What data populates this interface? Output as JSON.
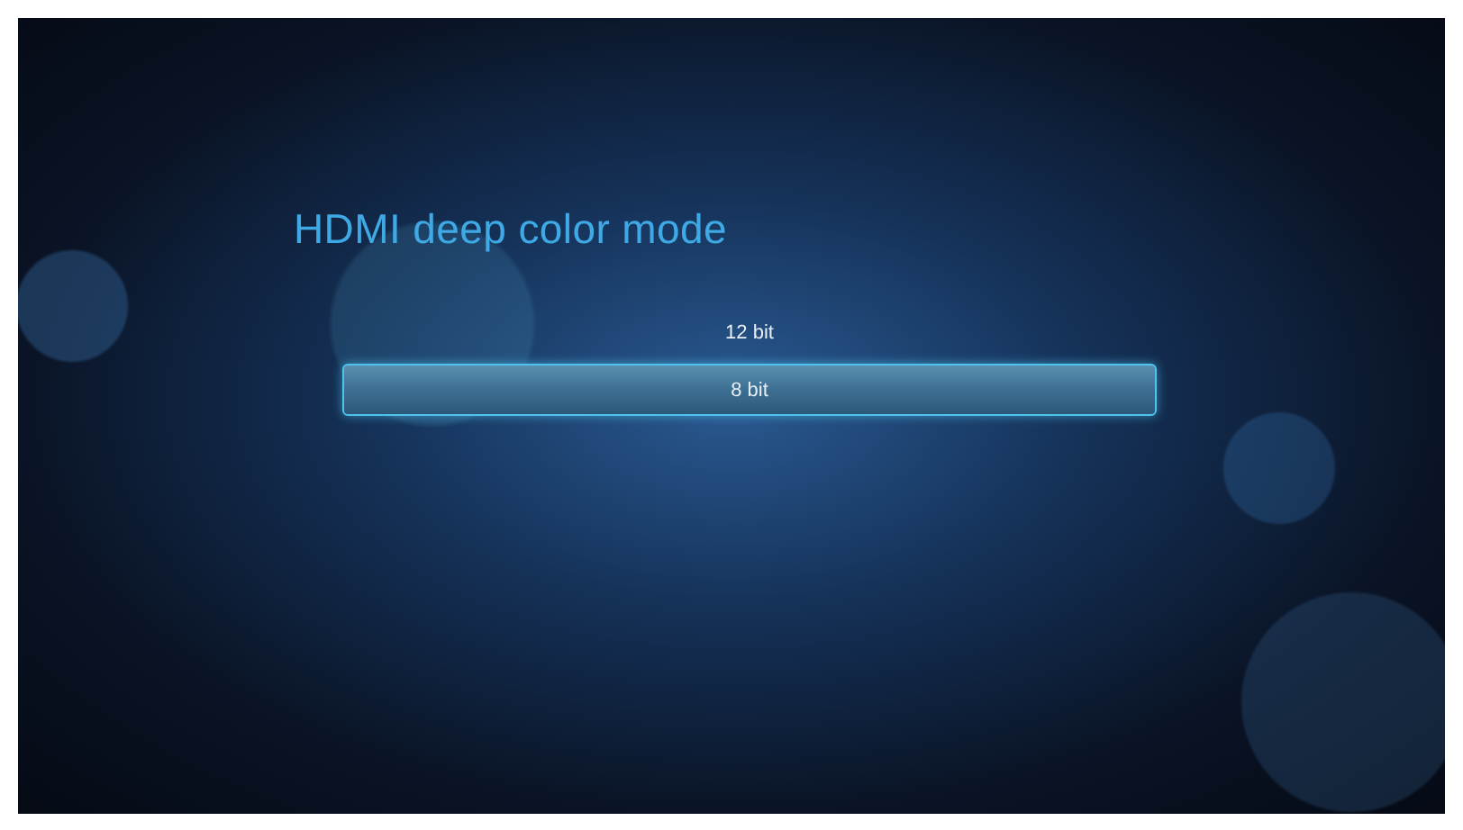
{
  "title": "HDMI deep color mode",
  "options": [
    {
      "label": "12 bit",
      "selected": false
    },
    {
      "label": "8 bit",
      "selected": true
    }
  ]
}
